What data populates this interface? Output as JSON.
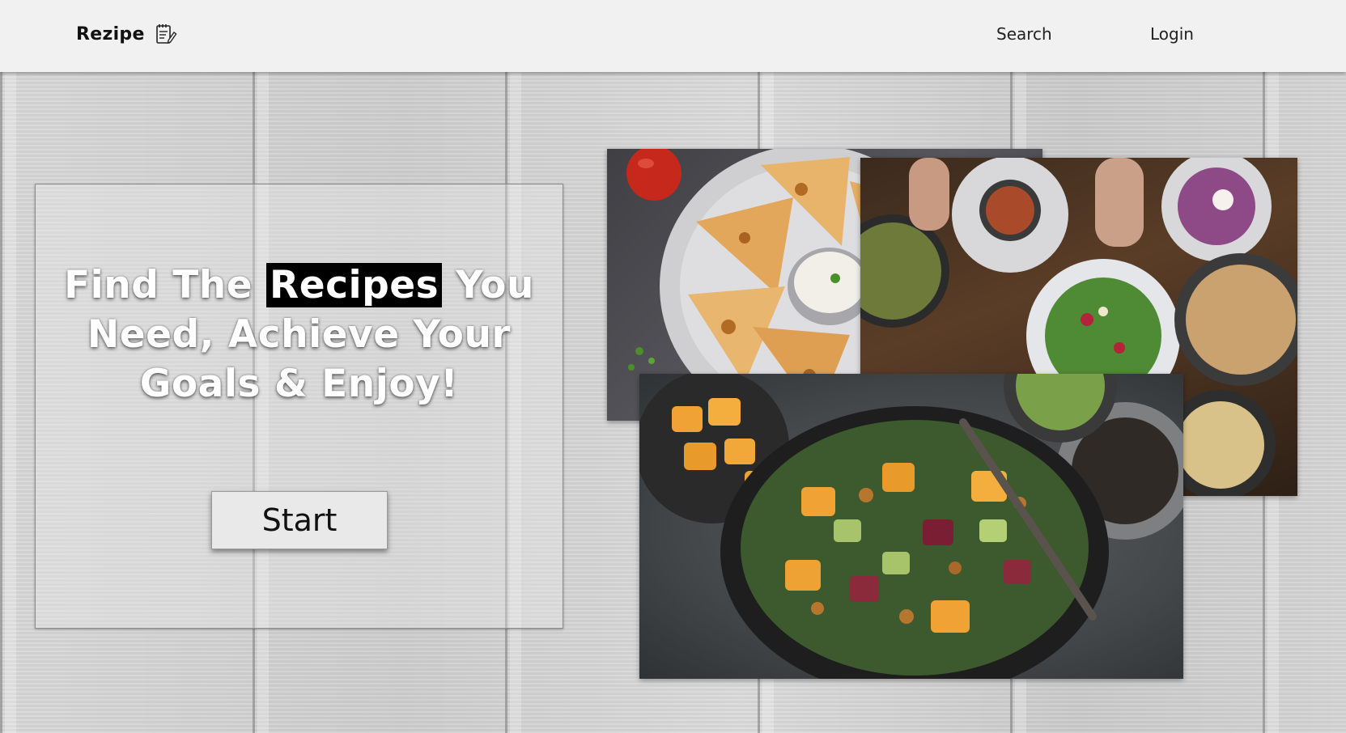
{
  "header": {
    "brand": "Rezipe",
    "brand_icon": "recipe-notepad-icon",
    "nav": {
      "search_label": "Search",
      "login_label": "Login"
    }
  },
  "hero": {
    "title_before": "Find The",
    "title_highlight": "Recipes",
    "title_after": "You Need, Achieve Your Goals & Enjoy!",
    "start_label": "Start"
  },
  "images": {
    "photo_1": "quesadilla-plate-photo",
    "photo_2": "dinner-table-spread-photo",
    "photo_3": "roasted-vegetable-salad-bowl-photo"
  },
  "colors": {
    "header_bg": "#f1f1f1",
    "highlight_bg": "#000000",
    "title_text": "#ffffff",
    "button_bg": "#e9e9e9"
  }
}
